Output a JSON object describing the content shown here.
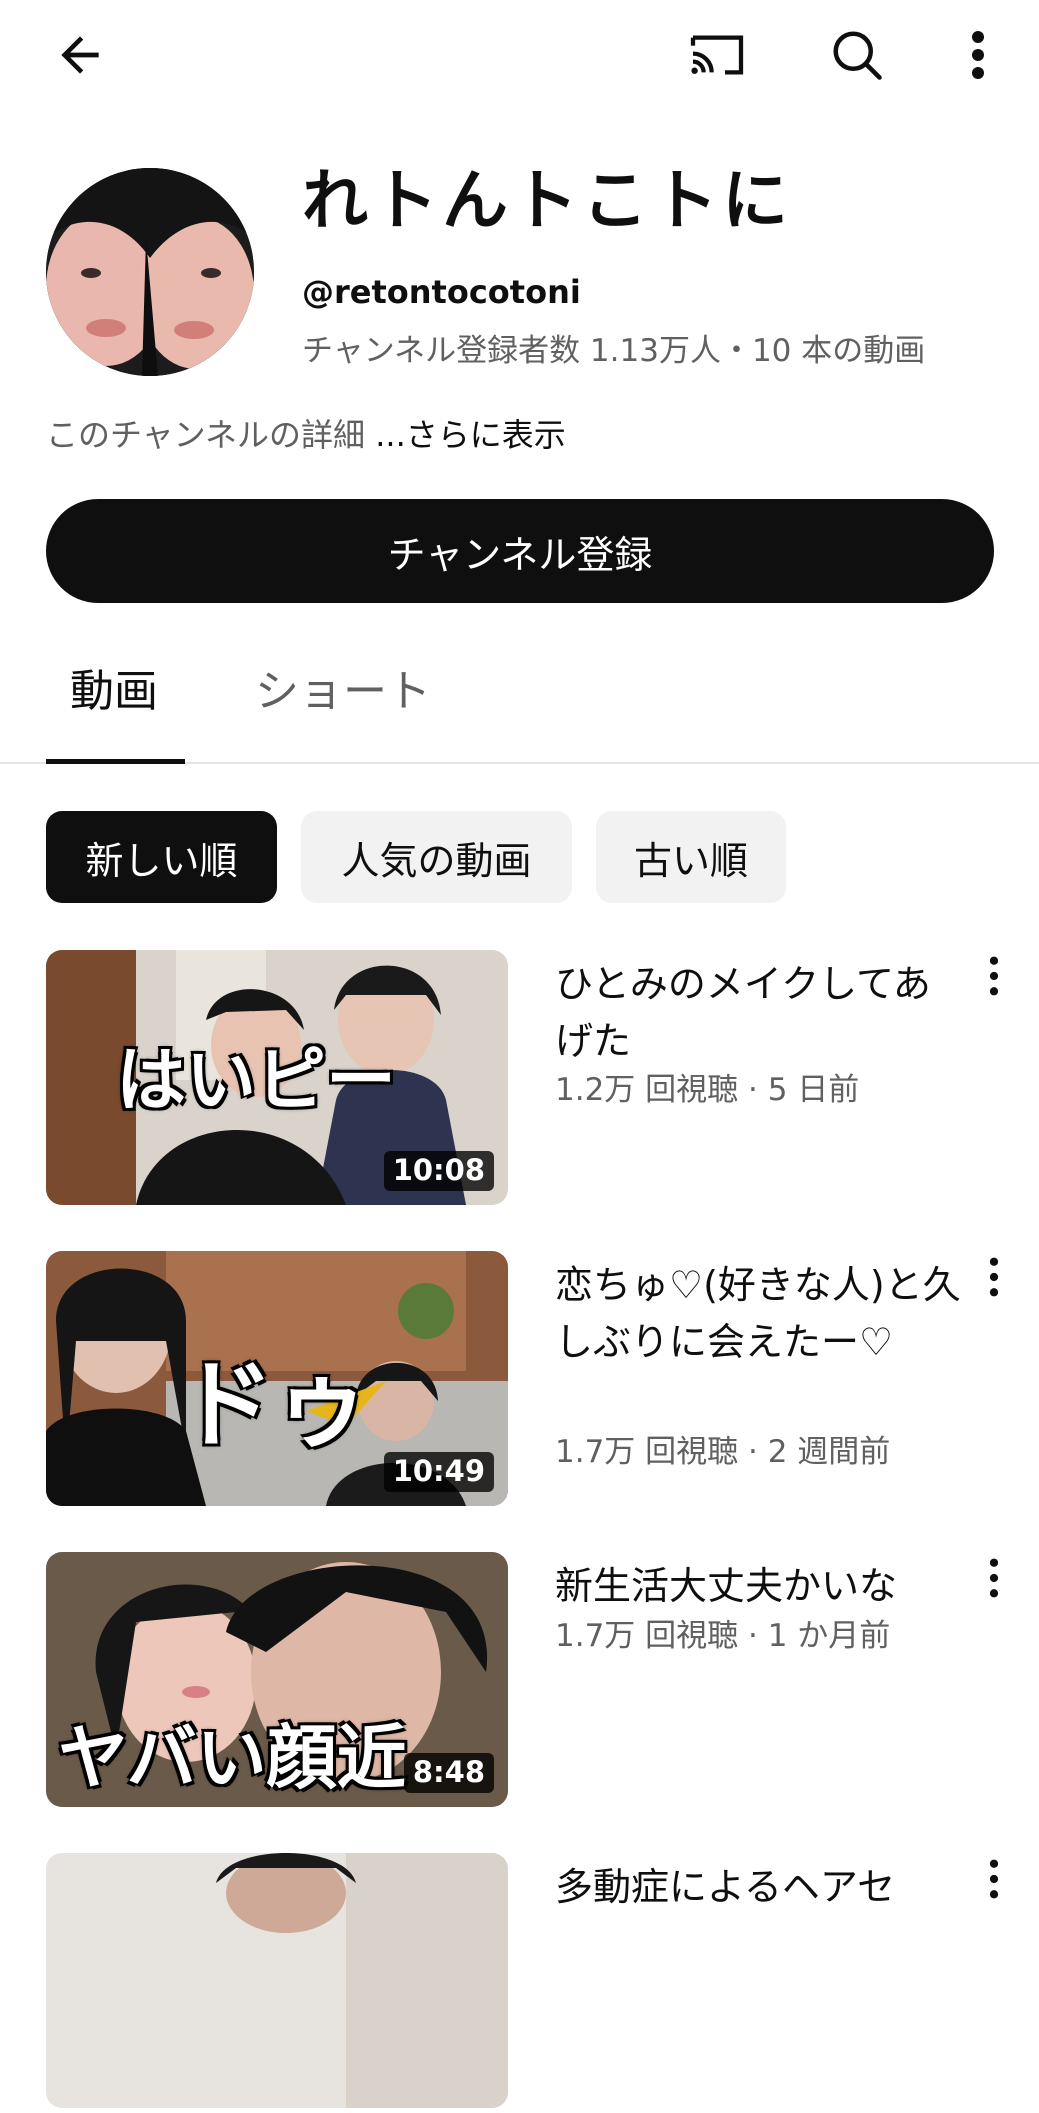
{
  "header": {
    "back_icon": "arrow-left-icon",
    "cast_icon": "cast-icon",
    "search_icon": "search-icon",
    "more_icon": "more-vertical-icon"
  },
  "channel": {
    "title": "れトんトこトに",
    "handle": "@retontocotoni",
    "stats": "チャンネル登録者数 1.13万人・10 本の動画",
    "description": "このチャンネルの詳細 ",
    "description_more": "...さらに表示",
    "subscribe_label": "チャンネル登録"
  },
  "tabs": [
    {
      "label": "動画",
      "active": true
    },
    {
      "label": "ショート",
      "active": false
    }
  ],
  "chips": [
    {
      "label": "新しい順",
      "selected": true
    },
    {
      "label": "人気の動画",
      "selected": false
    },
    {
      "label": "古い順",
      "selected": false
    }
  ],
  "videos": [
    {
      "title": "ひとみのメイクしてあげた",
      "meta": "1.2万 回視聴 · 5 日前",
      "duration": "10:08",
      "thumb_text": "はいピー"
    },
    {
      "title": "恋ちゅ♡(好きな人)と久しぶりに会えたー♡",
      "meta": "1.7万 回視聴 · 2 週間前",
      "duration": "10:49",
      "thumb_text": "ドゥ"
    },
    {
      "title": "新生活大丈夫かいな",
      "meta": "1.7万 回視聴 · 1 か月前",
      "duration": "8:48",
      "thumb_text": "ヤバい顔近"
    },
    {
      "title": "多動症によるヘアセ",
      "meta": "",
      "duration": "",
      "thumb_text": ""
    }
  ],
  "colors": {
    "text_primary": "#0f0f0f",
    "text_secondary": "#606060",
    "chip_bg": "#f2f2f2",
    "divider": "#e5e5e5"
  }
}
